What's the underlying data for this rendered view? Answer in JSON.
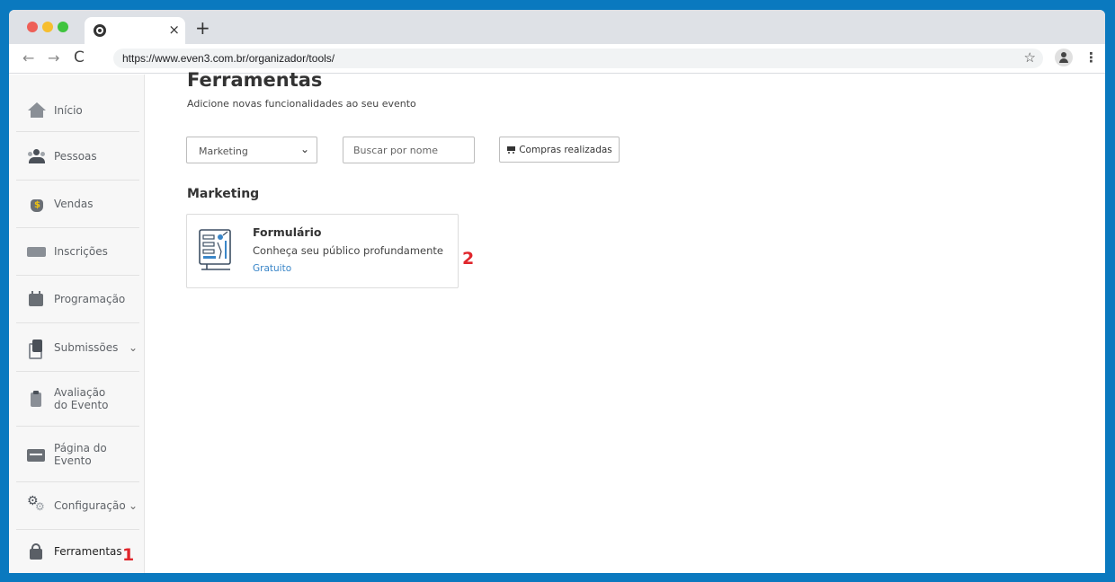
{
  "browser": {
    "tab_close": "×",
    "new_tab": "+",
    "url": "https://www.even3.com.br/organizador/tools/",
    "nav_back": "←",
    "nav_forward": "→",
    "nav_reload": "C",
    "star": "☆",
    "menu": "⋮"
  },
  "sidebar": {
    "items": [
      {
        "label": "Início",
        "icon": "home-icon"
      },
      {
        "label": "Pessoas",
        "icon": "people-icon"
      },
      {
        "label": "Vendas",
        "icon": "money-bag-icon"
      },
      {
        "label": "Inscrições",
        "icon": "ticket-icon"
      },
      {
        "label": "Programação",
        "icon": "calendar-icon"
      },
      {
        "label": "Submissões",
        "icon": "documents-icon",
        "chevron": "⌄"
      },
      {
        "label_line1": "Avaliação",
        "label_line2": "do Evento",
        "icon": "clipboard-icon"
      },
      {
        "label_line1": "Página do",
        "label_line2": "Evento",
        "icon": "page-icon"
      },
      {
        "label": "Configuração",
        "icon": "gears-icon",
        "chevron": "⌄"
      },
      {
        "label": "Ferramentas",
        "icon": "lock-icon",
        "active": true
      }
    ]
  },
  "markers": {
    "one": "1",
    "two": "2"
  },
  "main": {
    "title": "Ferramentas",
    "subtitle": "Adicione novas funcionalidades ao seu evento",
    "filter": {
      "selected": "Marketing",
      "caret": "⌄"
    },
    "search": {
      "placeholder": "Buscar por nome",
      "value": ""
    },
    "purchases_button": "Compras realizadas",
    "section_title": "Marketing",
    "card": {
      "title": "Formulário",
      "description": "Conheça seu público profundamente",
      "price": "Gratuito",
      "icon": "form-icon"
    }
  },
  "colors": {
    "frame": "#0a79bf",
    "accent_link": "#3a86c8",
    "marker": "#e0262c"
  }
}
